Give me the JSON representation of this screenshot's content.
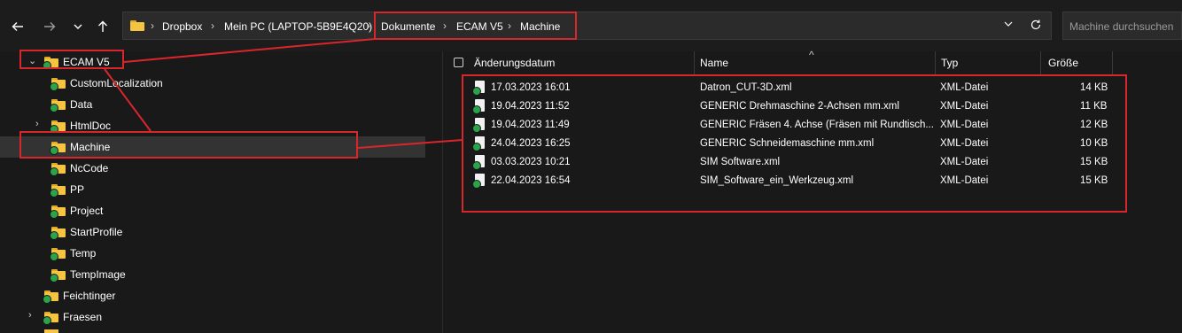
{
  "nav": {
    "back_icon": "back-arrow-icon",
    "forward_icon": "forward-arrow-icon",
    "recent_icon": "chevron-down-icon",
    "up_icon": "up-arrow-icon"
  },
  "address": {
    "crumbs": [
      "Dropbox",
      "Mein PC (LAPTOP-5B9E4Q20)",
      "Dokumente",
      "ECAM V5",
      "Machine"
    ]
  },
  "search": {
    "placeholder": "Machine durchsuchen"
  },
  "tree": {
    "items": [
      {
        "label": "ECAM V5",
        "expanded": true
      },
      {
        "label": "CustomLocalization"
      },
      {
        "label": "Data"
      },
      {
        "label": "HtmlDoc",
        "collapsible": true
      },
      {
        "label": "Machine",
        "selected": true
      },
      {
        "label": "NcCode"
      },
      {
        "label": "PP"
      },
      {
        "label": "Project"
      },
      {
        "label": "StartProfile"
      },
      {
        "label": "Temp"
      },
      {
        "label": "TempImage"
      },
      {
        "label": "Feichtinger"
      },
      {
        "label": "Fraesen",
        "collapsible": true
      }
    ]
  },
  "table": {
    "columns": [
      "Änderungsdatum",
      "Name",
      "Typ",
      "Größe"
    ],
    "sort_indicator": "^",
    "rows": [
      {
        "date": "17.03.2023 16:01",
        "name": "Datron_CUT-3D.xml",
        "type": "XML-Datei",
        "size": "14 KB"
      },
      {
        "date": "19.04.2023 11:52",
        "name": "GENERIC Drehmaschine 2-Achsen mm.xml",
        "type": "XML-Datei",
        "size": "11 KB"
      },
      {
        "date": "19.04.2023 11:49",
        "name": "GENERIC Fräsen 4. Achse (Fräsen mit Rundtisch...",
        "type": "XML-Datei",
        "size": "12 KB"
      },
      {
        "date": "24.04.2023 16:25",
        "name": "GENERIC Schneidemaschine mm.xml",
        "type": "XML-Datei",
        "size": "10 KB"
      },
      {
        "date": "03.03.2023 10:21",
        "name": "SIM Software.xml",
        "type": "XML-Datei",
        "size": "15 KB"
      },
      {
        "date": "22.04.2023 16:54",
        "name": "SIM_Software_ein_Werkzeug.xml",
        "type": "XML-Datei",
        "size": "15 KB"
      }
    ]
  },
  "colors": {
    "accent_red": "#d9262c",
    "folder_yellow": "#f5c542",
    "sync_green": "#2aa34a"
  }
}
